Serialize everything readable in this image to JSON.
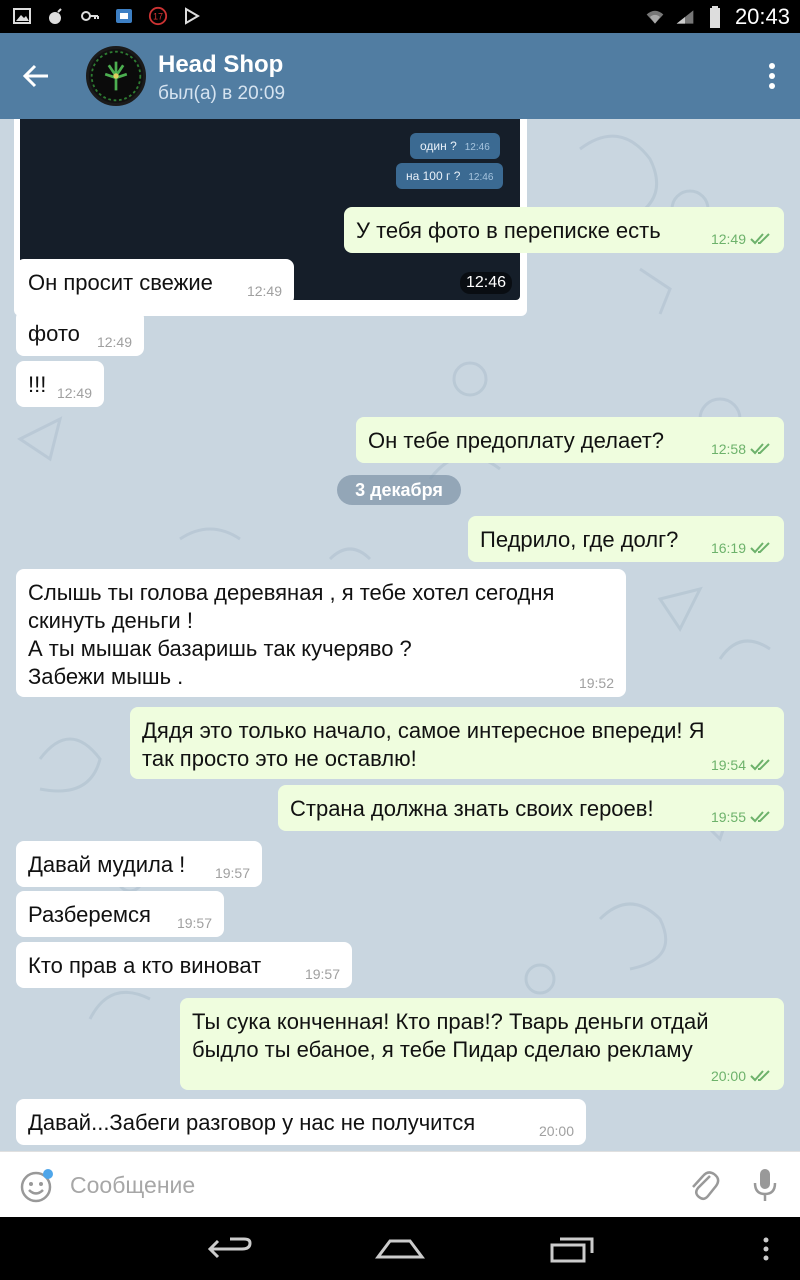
{
  "status_bar": {
    "time": "20:43",
    "notification_badge": "17"
  },
  "header": {
    "title": "Head Shop",
    "subtitle": "был(а) в 20:09"
  },
  "photo": {
    "mini_messages": [
      {
        "text": "один ?",
        "time": "12:46"
      },
      {
        "text": "на 100 г ?",
        "time": "12:46"
      }
    ],
    "time": "12:46"
  },
  "date_separator": "3 декабря",
  "messages": [
    {
      "dir": "out",
      "text": "У тебя фото в переписке есть",
      "time": "12:49"
    },
    {
      "dir": "in",
      "text": "Он просит свежие",
      "time": "12:49"
    },
    {
      "dir": "in",
      "text": "фото",
      "time": "12:49"
    },
    {
      "dir": "in",
      "text": "!!!",
      "time": "12:49"
    },
    {
      "dir": "out",
      "text": "Он тебе предоплату  делает?",
      "time": "12:58"
    },
    {
      "dir": "out",
      "text": "Педрило, где долг?",
      "time": "16:19"
    },
    {
      "dir": "in",
      "lines": [
        "Слышь ты голова деревяная , я тебе хотел сегодня",
        "скинуть деньги !",
        "А ты мышак базаришь так кучеряво ?",
        "Забежи мышь ."
      ],
      "time": "19:52"
    },
    {
      "dir": "out",
      "lines": [
        "Дядя это только начало, самое интересное впереди! Я",
        "так просто это не оставлю!"
      ],
      "time": "19:54"
    },
    {
      "dir": "out",
      "text": "Страна должна знать своих героев!",
      "time": "19:55"
    },
    {
      "dir": "in",
      "text": "Давай мудила !",
      "time": "19:57"
    },
    {
      "dir": "in",
      "text": "Разберемся",
      "time": "19:57"
    },
    {
      "dir": "in",
      "text": "Кто прав а кто виноват",
      "time": "19:57"
    },
    {
      "dir": "out",
      "lines": [
        "Ты сука конченная! Кто прав!? Тварь деньги отдай",
        "быдло ты ебаное, я тебе Пидар сделаю рекламу"
      ],
      "time": "20:00"
    },
    {
      "dir": "in",
      "text": "Давай...Забеги разговор у нас не получится",
      "time": "20:00"
    }
  ],
  "input": {
    "placeholder": "Сообщение"
  },
  "colors": {
    "header": "#517da2",
    "chat_background": "#c9d6e0",
    "incoming_bubble": "#ffffff",
    "outgoing_bubble": "#effdde",
    "read_check": "#6db26b"
  },
  "icons": {
    "back": "arrow-left-icon",
    "menu": "more-vertical-icon",
    "emoji": "smile-icon",
    "attach": "paperclip-icon",
    "mic": "microphone-icon"
  }
}
